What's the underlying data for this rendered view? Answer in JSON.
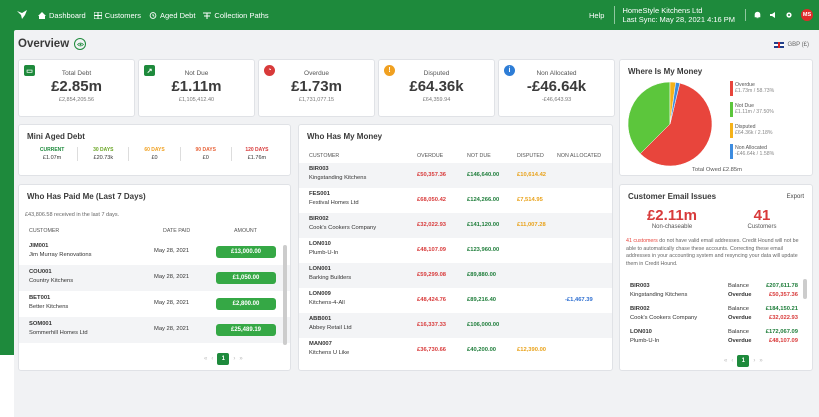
{
  "nav": {
    "items": [
      {
        "label": "Dashboard",
        "icon": "home-icon"
      },
      {
        "label": "Customers",
        "icon": "table-icon"
      },
      {
        "label": "Aged Debt",
        "icon": "clock-icon"
      },
      {
        "label": "Collection Paths",
        "icon": "paths-icon"
      }
    ],
    "help": "Help",
    "company": "HomeStyle Kitchens Ltd",
    "last_sync": "Last Sync: May 28, 2021 4:16 PM",
    "avatar": "MS"
  },
  "page": {
    "title": "Overview",
    "currency": "GBP (£)"
  },
  "stats": [
    {
      "label": "Total Debt",
      "value": "£2.85m",
      "sub": "£2,854,205.56",
      "color": "#1e8a3c",
      "icon": "money-icon"
    },
    {
      "label": "Not Due",
      "value": "£1.11m",
      "sub": "£1,105,412.40",
      "color": "#1e8a3c",
      "icon": "chart-up-icon"
    },
    {
      "label": "Overdue",
      "value": "£1.73m",
      "sub": "£1,731,077.15",
      "color": "#d83a3a",
      "icon": "clock-icon"
    },
    {
      "label": "Disputed",
      "value": "£64.36k",
      "sub": "£64,359.94",
      "color": "#f0a020",
      "icon": "warning-icon"
    },
    {
      "label": "Non Allocated",
      "value": "-£46.64k",
      "sub": "-£46,643.93",
      "color": "#2e7dd6",
      "icon": "info-icon"
    }
  ],
  "aged_debt": {
    "title": "Mini Aged Debt",
    "columns": [
      {
        "label": "CURRENT",
        "value": "£1.07m",
        "color": "#1e8a3c"
      },
      {
        "label": "30 DAYS",
        "value": "£20.73k",
        "color": "#6aa625"
      },
      {
        "label": "60 DAYS",
        "value": "£0",
        "color": "#f0a020"
      },
      {
        "label": "90 DAYS",
        "value": "£0",
        "color": "#e8643a"
      },
      {
        "label": "120 DAYS",
        "value": "£1.76m",
        "color": "#d83a3a"
      }
    ]
  },
  "paid": {
    "title": "Who Has Paid Me (Last 7 Days)",
    "summary": "£43,806.58 received in the last 7 days.",
    "headers": [
      "CUSTOMER",
      "DATE PAID",
      "AMOUNT"
    ],
    "rows": [
      {
        "code": "JIM001",
        "name": "Jim Murray Renovations",
        "date": "May 28, 2021",
        "amount": "£13,000.00"
      },
      {
        "code": "COU001",
        "name": "Country Kitchens",
        "date": "May 28, 2021",
        "amount": "£1,050.00"
      },
      {
        "code": "BET001",
        "name": "Better Kitchens",
        "date": "May 28, 2021",
        "amount": "£2,800.00"
      },
      {
        "code": "SOM001",
        "name": "Sommerhill Homes Ltd",
        "date": "May 28, 2021",
        "amount": "£25,489.19"
      }
    ],
    "page": "1"
  },
  "owes": {
    "title": "Who Has My Money",
    "headers": [
      "CUSTOMER",
      "OVERDUE",
      "NOT DUE",
      "DISPUTED",
      "NON ALLOCATED"
    ],
    "rows": [
      {
        "code": "BIR003",
        "name": "Kingstanding Kitchens",
        "overdue": "£50,357.36",
        "notdue": "£146,640.00",
        "disputed": "£10,614.42",
        "nonalloc": ""
      },
      {
        "code": "FES001",
        "name": "Festival Homes Ltd",
        "overdue": "£68,050.42",
        "notdue": "£124,266.00",
        "disputed": "£7,514.95",
        "nonalloc": ""
      },
      {
        "code": "BIR002",
        "name": "Cook's Cookers Company",
        "overdue": "£32,022.93",
        "notdue": "£141,120.00",
        "disputed": "£11,007.28",
        "nonalloc": ""
      },
      {
        "code": "LON010",
        "name": "Plumb-U-In",
        "overdue": "£48,107.09",
        "notdue": "£123,960.00",
        "disputed": "",
        "nonalloc": ""
      },
      {
        "code": "LON001",
        "name": "Barking Builders",
        "overdue": "£59,299.08",
        "notdue": "£89,880.00",
        "disputed": "",
        "nonalloc": ""
      },
      {
        "code": "LON009",
        "name": "Kitchens-4-All",
        "overdue": "£48,424.76",
        "notdue": "£89,216.40",
        "disputed": "",
        "nonalloc": "-£1,467.39"
      },
      {
        "code": "ABB001",
        "name": "Abbey Retail Ltd",
        "overdue": "£16,337.33",
        "notdue": "£106,000.00",
        "disputed": "",
        "nonalloc": ""
      },
      {
        "code": "MAN007",
        "name": "Kitchens U Like",
        "overdue": "£36,730.66",
        "notdue": "£40,200.00",
        "disputed": "£12,390.00",
        "nonalloc": ""
      }
    ]
  },
  "where": {
    "title": "Where Is My Money",
    "legend": [
      {
        "name": "Overdue",
        "value": "£1.73m / 58.73%",
        "color": "#e8453c"
      },
      {
        "name": "Not Due",
        "value": "£1.11m / 37.50%",
        "color": "#5cc63c"
      },
      {
        "name": "Disputed",
        "value": "£64.36k / 2.18%",
        "color": "#f5b21a"
      },
      {
        "name": "Non Allocated",
        "value": "-£46.64k / 1.58%",
        "color": "#3d8ce0"
      }
    ],
    "total": "Total Owed £2.85m"
  },
  "chart_data": {
    "type": "pie",
    "categories": [
      "Overdue",
      "Not Due",
      "Disputed",
      "Non Allocated"
    ],
    "values": [
      58.73,
      37.5,
      2.18,
      1.58
    ],
    "colors": [
      "#e8453c",
      "#5cc63c",
      "#f5b21a",
      "#3d8ce0"
    ],
    "title": "Where Is My Money"
  },
  "email": {
    "title": "Customer Email Issues",
    "export": "Export",
    "amount": "£2.11m",
    "amount_label": "Non-chaseable",
    "count": "41",
    "count_label": "Customers",
    "msg_link": "41 customers",
    "msg": " do not have valid email addresses. Credit Hound will not be able to automatically chase these accounts. Correcting these email addresses in your accounting system and resyncing your data will update them in Credit Hound.",
    "rows": [
      {
        "code": "BIR003",
        "name": "Kingstanding Kitchens",
        "balance_label": "Balance",
        "balance": "£207,611.78",
        "overdue_label": "Overdue",
        "overdue": "£50,357.36"
      },
      {
        "code": "BIR002",
        "name": "Cook's Cookers Company",
        "balance_label": "Balance",
        "balance": "£184,150.21",
        "overdue_label": "Overdue",
        "overdue": "£32,022.93"
      },
      {
        "code": "LON010",
        "name": "Plumb-U-In",
        "balance_label": "Balance",
        "balance": "£172,067.09",
        "overdue_label": "Overdue",
        "overdue": "£48,107.09"
      }
    ],
    "page": "1"
  }
}
